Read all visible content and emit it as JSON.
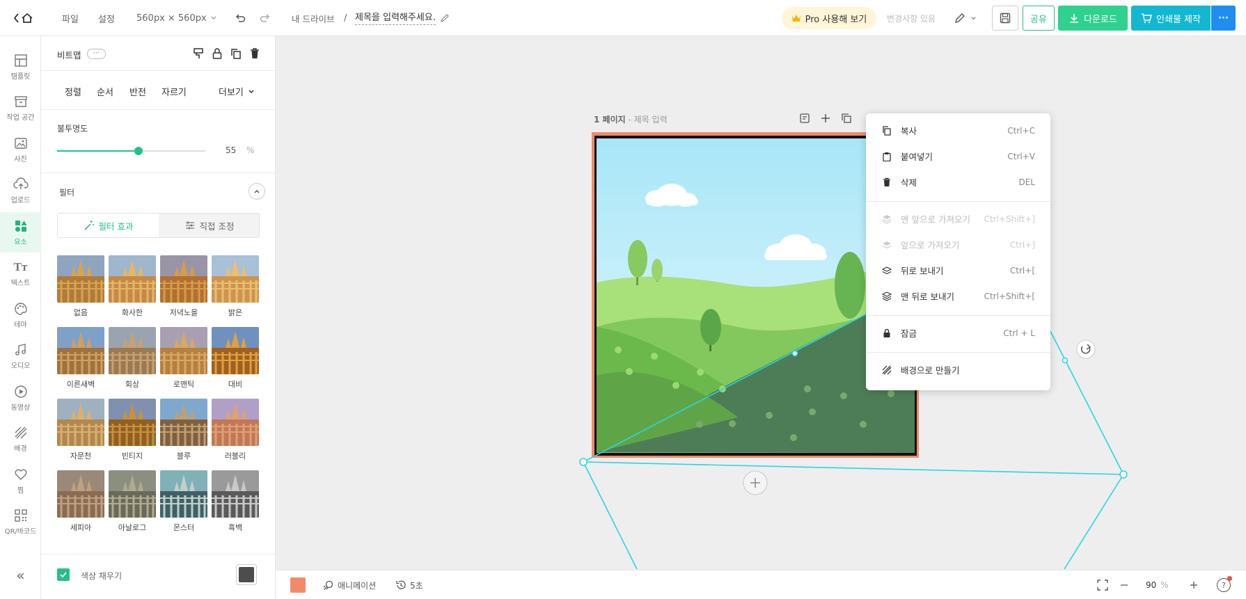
{
  "topbar": {
    "menu_file": "파일",
    "menu_settings": "설정",
    "canvas_size": "560px × 560px",
    "breadcrumb_root": "내 드라이브",
    "breadcrumb_sep": "/",
    "doc_title": "제목을 입력해주세요.",
    "pro_label": "Pro 사용해 보기",
    "saved_status": "변경사항 있음",
    "share_label": "공유",
    "download_label": "다운로드",
    "print_label": "인쇄물 제작",
    "more_label": "···"
  },
  "leftnav": {
    "items": [
      {
        "label": "템플릿",
        "icon": "template-icon"
      },
      {
        "label": "작업 공간",
        "icon": "workspace-icon"
      },
      {
        "label": "사진",
        "icon": "photo-icon"
      },
      {
        "label": "업로드",
        "icon": "upload-icon"
      },
      {
        "label": "요소",
        "icon": "elements-icon"
      },
      {
        "label": "텍스트",
        "icon": "text-icon"
      },
      {
        "label": "테마",
        "icon": "palette-icon"
      },
      {
        "label": "오디오",
        "icon": "audio-icon"
      },
      {
        "label": "동영상",
        "icon": "video-icon"
      },
      {
        "label": "배경",
        "icon": "background-icon"
      },
      {
        "label": "찜",
        "icon": "heart-icon"
      },
      {
        "label": "QR/바코드",
        "icon": "qr-icon"
      }
    ],
    "active_index": 4,
    "collapse_label": "«"
  },
  "panel": {
    "element_type": "비트맵",
    "more_dots": "···",
    "tabs": [
      "정렬",
      "순서",
      "반전",
      "자르기"
    ],
    "more_label": "더보기",
    "opacity_label": "불투명도",
    "opacity_value": "55",
    "opacity_unit": "%",
    "opacity_fraction": 0.55,
    "filter_title": "필터",
    "filter_tab_effects": "필터 효과",
    "filter_tab_manual": "직접 조정",
    "filters": [
      "없음",
      "화사한",
      "저녁노을",
      "밝은",
      "이른새벽",
      "회상",
      "로맨틱",
      "대비",
      "자문천",
      "빈티지",
      "블루",
      "러블리",
      "세피아",
      "아날로그",
      "몬스터",
      "흑백"
    ],
    "fill_label": "색상 채우기",
    "fill_color": "#4d4d4d",
    "accent_color": "#23c08a"
  },
  "canvas": {
    "page_label": "1 페이지",
    "page_title_placeholder": "- 제목 입력",
    "add_page": "+"
  },
  "context_menu": {
    "items": [
      {
        "label": "복사",
        "shortcut": "Ctrl+C",
        "icon": "copy-icon",
        "enabled": true
      },
      {
        "label": "붙여넣기",
        "shortcut": "Ctrl+V",
        "icon": "paste-icon",
        "enabled": true
      },
      {
        "label": "삭제",
        "shortcut": "DEL",
        "icon": "trash-icon",
        "enabled": true
      },
      {
        "label": "맨 앞으로 가져오기",
        "shortcut": "Ctrl+Shift+]",
        "icon": "bring-front-icon",
        "enabled": false
      },
      {
        "label": "앞으로 가져오기",
        "shortcut": "Ctrl+]",
        "icon": "bring-forward-icon",
        "enabled": false
      },
      {
        "label": "뒤로 보내기",
        "shortcut": "Ctrl+[",
        "icon": "send-backward-icon",
        "enabled": true
      },
      {
        "label": "맨 뒤로 보내기",
        "shortcut": "Ctrl+Shift+[",
        "icon": "send-back-icon",
        "enabled": true
      },
      {
        "label": "잠금",
        "shortcut": "Ctrl + L",
        "icon": "lock-icon",
        "enabled": true
      },
      {
        "label": "배경으로 만들기",
        "shortcut": "",
        "icon": "background-icon",
        "enabled": true
      }
    ]
  },
  "bottombar": {
    "page_color": "#f28a6a",
    "animation_label": "애니메이션",
    "duration_label": "5초",
    "zoom_value": "90",
    "zoom_unit": "%",
    "help": "?"
  }
}
